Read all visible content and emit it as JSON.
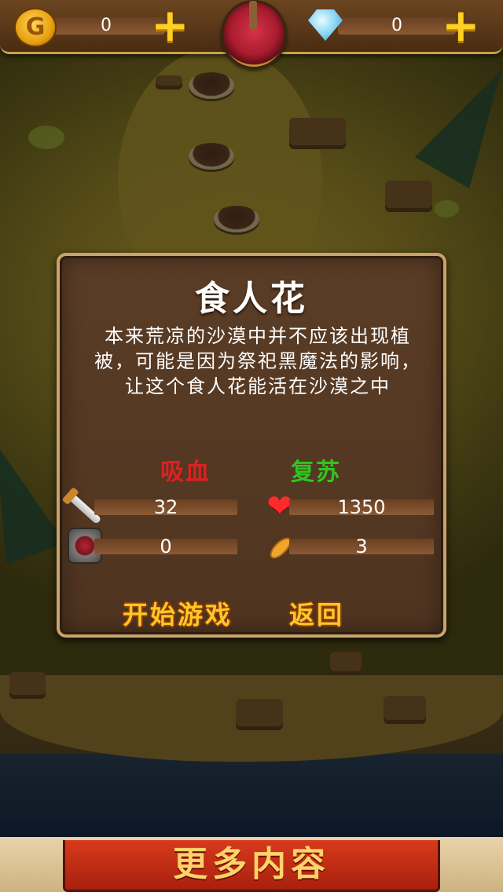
{
  "hud": {
    "coins": "0",
    "gems": "0",
    "coin_icon_symbol": "G",
    "plus_symbol": "+"
  },
  "dialog": {
    "title": "食人花",
    "description": "本来荒凉的沙漠中并不应该出现植被，可能是因为祭祀黑魔法的影响，让这个食人花能活在沙漠之中",
    "skill_left": "吸血",
    "skill_right": "复苏",
    "skill_left_color": "#e02020",
    "skill_right_color": "#2fc61f",
    "stats": {
      "attack": "32",
      "health": "1350",
      "defense": "0",
      "speed": "3"
    },
    "heart_symbol": "❤",
    "start_label": "开始游戏",
    "back_label": "返回"
  },
  "footer": {
    "more_label": "更多内容"
  },
  "icons": [
    "coin-icon",
    "gem-icon",
    "plus-icon",
    "emblem-icon",
    "sword-icon",
    "shield-icon",
    "heart-icon",
    "feather-icon"
  ]
}
